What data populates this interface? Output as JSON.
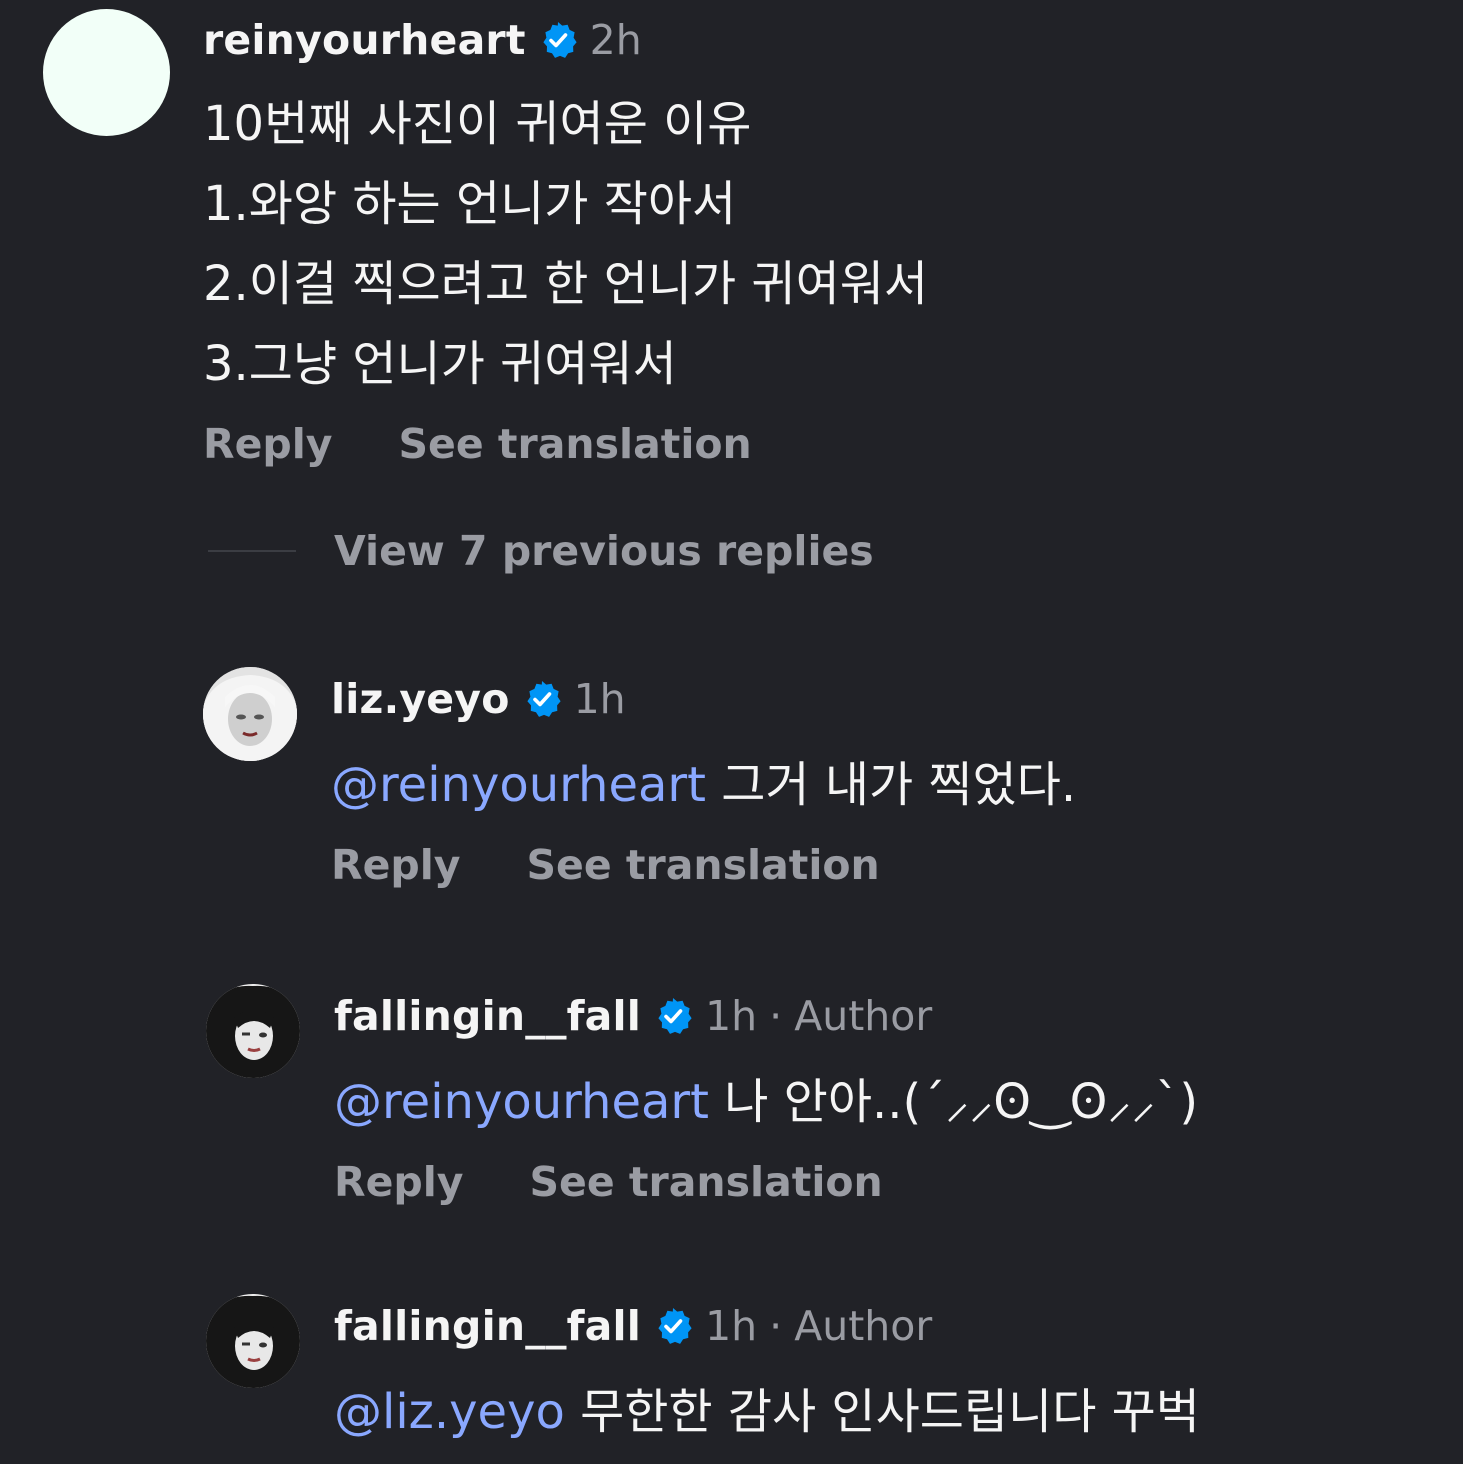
{
  "comments": [
    {
      "username": "reinyourheart",
      "time": "2h",
      "lines": [
        "10번째 사진이 귀여운 이유",
        "1.와앙 하는 언니가 작아서",
        "2.이걸 찍으려고 한 언니가 귀여워서",
        "3.그냥 언니가 귀여워서"
      ],
      "reply_label": "Reply",
      "translate_label": "See translation"
    }
  ],
  "view_replies": "View 7 previous replies",
  "replies": [
    {
      "username": "liz.yeyo",
      "time": "1h",
      "mention": "@reinyourheart",
      "text": " 그거 내가 찍었다.",
      "reply_label": "Reply",
      "translate_label": "See translation"
    },
    {
      "username": "fallingin__fall",
      "time": "1h",
      "dot": "·",
      "badge": "Author",
      "mention": "@reinyourheart",
      "text": " 나 안아..(´‪⸝⸝ʘ‿ʘ⸝⸝`)",
      "reply_label": "Reply",
      "translate_label": "See translation"
    },
    {
      "username": "fallingin__fall",
      "time": "1h",
      "dot": "·",
      "badge": "Author",
      "mention": "@liz.yeyo",
      "text": " 무한한 감사 인사드립니다 꾸벅"
    }
  ],
  "colors": {
    "background": "#212227",
    "verified": "#0095f6",
    "mention": "#8aa8ff",
    "secondary_text": "#9a9ca3"
  }
}
